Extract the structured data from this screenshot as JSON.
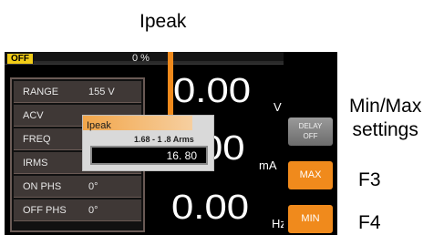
{
  "annotations": {
    "ipeak": "Ipeak",
    "minmax_line1": "Min/Max",
    "minmax_line2": "settings",
    "f3": "F3",
    "f4": "F4"
  },
  "status_bar": {
    "output_state": "OFF",
    "percent": "0 %"
  },
  "params": [
    {
      "label": "RANGE",
      "value": "155 V"
    },
    {
      "label": "ACV",
      "value": ""
    },
    {
      "label": "FREQ",
      "value": ""
    },
    {
      "label": "IRMS",
      "value": ""
    },
    {
      "label": "ON PHS",
      "value": "0°"
    },
    {
      "label": "OFF PHS",
      "value": "0°"
    }
  ],
  "readouts": {
    "voltage": {
      "value": "0.00",
      "unit": "V"
    },
    "current": {
      "value": "00",
      "unit": "mA"
    },
    "frequency": {
      "value": "0.00",
      "unit": "Hz"
    }
  },
  "popup": {
    "title": "Ipeak",
    "range": "1.68 - 1 .8 Arms",
    "value": "16. 80"
  },
  "softkeys": {
    "delay_line1": "DELAY",
    "delay_line2": "OFF",
    "max": "MAX",
    "min": "MIN"
  },
  "colors": {
    "accent": "#f08a1c",
    "status_badge": "#f1cc17",
    "screen_bg": "#000000",
    "param_row": "#3f3836"
  }
}
